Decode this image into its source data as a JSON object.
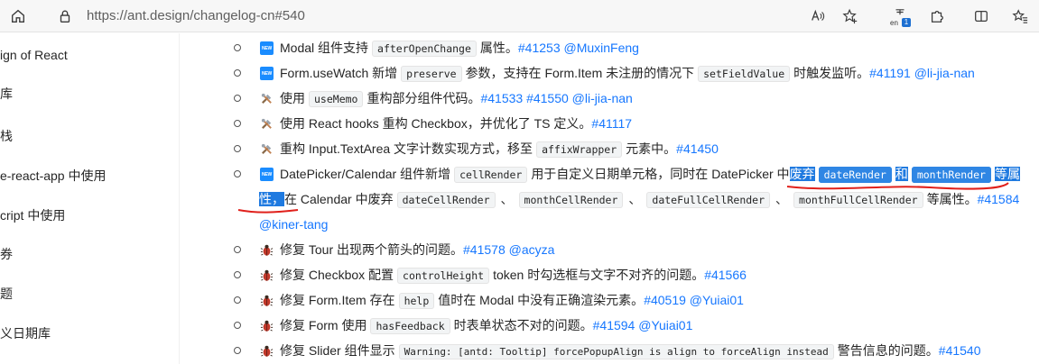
{
  "browser": {
    "url": "https://ant.design/changelog-cn#540"
  },
  "sidebar": {
    "items": [
      {
        "label": "ign of React"
      },
      {
        "label": "库"
      },
      {
        "label": "栈"
      },
      {
        "label": "e-react-app 中使用"
      },
      {
        "label": "cript 中使用"
      },
      {
        "label": "券"
      },
      {
        "label": "题"
      },
      {
        "label": "义日期库"
      }
    ]
  },
  "changelog": {
    "rows": [
      {
        "icon": "new",
        "a": "Modal 组件支持",
        "code1": "afterOpenChange",
        "b": "属性。",
        "links": "#41253 @MuxinFeng"
      },
      {
        "icon": "new",
        "a": "Form.useWatch 新增",
        "code1": "preserve",
        "b": "参数，支持在 Form.Item 未注册的情况下",
        "code2": "setFieldValue",
        "c": "时触发监听。",
        "links": "#41191 @li-jia-nan"
      },
      {
        "icon": "tools",
        "a": "使用",
        "code1": "useMemo",
        "b": "重构部分组件代码。",
        "links": "#41533 #41550 @li-jia-nan"
      },
      {
        "icon": "tools",
        "a": "使用 React hooks 重构 Checkbox，并优化了 TS 定义。",
        "links": "#41117"
      },
      {
        "icon": "tools",
        "a": "重构 Input.TextArea 文字计数实现方式，移至",
        "code1": "affixWrapper",
        "b": "元素中。",
        "links": "#41450"
      },
      {
        "icon": "new",
        "a": "DatePicker/Calendar 组件新增",
        "code1": "cellRender",
        "b": "用于自定义日期单元格，同时在 DatePicker 中",
        "sel1": "废弃",
        "code2": "dateRender",
        "sel2": "和",
        "code3": "monthRender",
        "sel3": "等属"
      },
      {
        "icon": "none",
        "sel4": "性，",
        "a": "在 Calendar 中废弃",
        "code1": "dateCellRender",
        "sep1": "、",
        "code2": "monthCellRender",
        "sep2": "、",
        "code3": "dateFullCellRender",
        "sep3": "、",
        "code4": "monthFullCellRender",
        "b": "等属性。",
        "links": "#41584"
      },
      {
        "icon": "none",
        "links": "@kiner-tang"
      },
      {
        "icon": "bug",
        "a": "修复 Tour 出现两个箭头的问题。",
        "links": "#41578 @acyza"
      },
      {
        "icon": "bug",
        "a": "修复 Checkbox 配置",
        "code1": "controlHeight",
        "b": "token 时勾选框与文字不对齐的问题。",
        "links": "#41566"
      },
      {
        "icon": "bug",
        "a": "修复 Form.Item 存在",
        "code1": "help",
        "b": "值时在 Modal 中没有正确渲染元素。",
        "links": "#40519 @Yuiai01"
      },
      {
        "icon": "bug",
        "a": "修复 Form 使用",
        "code1": "hasFeedback",
        "b": "时表单状态不对的问题。",
        "links": "#41594 @Yuiai01"
      },
      {
        "icon": "bug",
        "a": "修复 Slider 组件显示",
        "code1": "Warning: [antd: Tooltip] forcePopupAlign is align to forceAlign instead",
        "b": "警告信息的问题。",
        "links": "#41540"
      }
    ],
    "new_icon_text": "NEW"
  },
  "colors": {
    "link": "#1677ff",
    "selection": "#1f7ae0",
    "annotation": "#e0201b"
  }
}
